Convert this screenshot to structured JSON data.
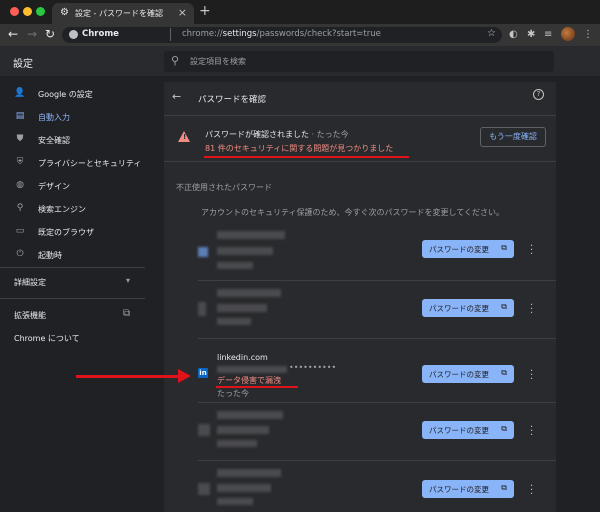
{
  "browser": {
    "tab_title": "設定 - パスワードを確認",
    "tab_close": "×",
    "new_tab": "+",
    "omnibox_site": "Chrome",
    "url_prefix": "chrome://",
    "url_bold": "settings",
    "url_suffix": "/passwords/check?start=true",
    "traffic_colors": [
      "#ff5f57",
      "#febc2e",
      "#28c840"
    ]
  },
  "settings": {
    "title": "設定",
    "search_placeholder": "設定項目を検索"
  },
  "sidebar": {
    "items": [
      {
        "label": "Google の設定",
        "icon": "person-icon",
        "glyph": "👤"
      },
      {
        "label": "自動入力",
        "icon": "autofill-icon",
        "glyph": "▤",
        "active": true
      },
      {
        "label": "安全確認",
        "icon": "shield-icon",
        "glyph": "⛊"
      },
      {
        "label": "プライバシーとセキュリティ",
        "icon": "shield-lock-icon",
        "glyph": "⛨"
      },
      {
        "label": "デザイン",
        "icon": "palette-icon",
        "glyph": "◍"
      },
      {
        "label": "検索エンジン",
        "icon": "search-icon",
        "glyph": "⚲"
      },
      {
        "label": "既定のブラウザ",
        "icon": "browser-icon",
        "glyph": "▭"
      },
      {
        "label": "起動時",
        "icon": "power-icon",
        "glyph": "⏻"
      }
    ],
    "advanced": "詳細設定",
    "extensions": "拡張機能",
    "about": "Chrome について"
  },
  "check": {
    "title": "パスワードを確認",
    "status_main": "パスワードが確認されました",
    "status_sub": " · たった今",
    "status_issues": "81 件のセキュリティに関する問題が見つかりました",
    "recheck_label": "もう一度確認",
    "section_title": "不正使用されたパスワード",
    "section_desc": "アカウントのセキュリティ保護のため、今すぐ次のパスワードを変更してください。"
  },
  "credentials": [
    {
      "site": "",
      "leak": "",
      "time": "",
      "blurred": true
    },
    {
      "site": "",
      "leak": "",
      "time": "",
      "blurred": true
    },
    {
      "site": "linkedin.com",
      "password_dots": "••••••••••",
      "leak": "データ侵害で漏洩",
      "time": "たった今",
      "blurred": false,
      "favicon_letter": "in"
    },
    {
      "site": "",
      "leak": "",
      "time": "",
      "blurred": true
    },
    {
      "site": "",
      "leak": "",
      "time": "",
      "blurred": true
    }
  ],
  "change_button_label": "パスワードの変更",
  "colors": {
    "accent": "#8ab4f8",
    "error": "#f28b82",
    "annotation_red": "#e0131a",
    "linkedin_blue": "#0a66c2"
  }
}
